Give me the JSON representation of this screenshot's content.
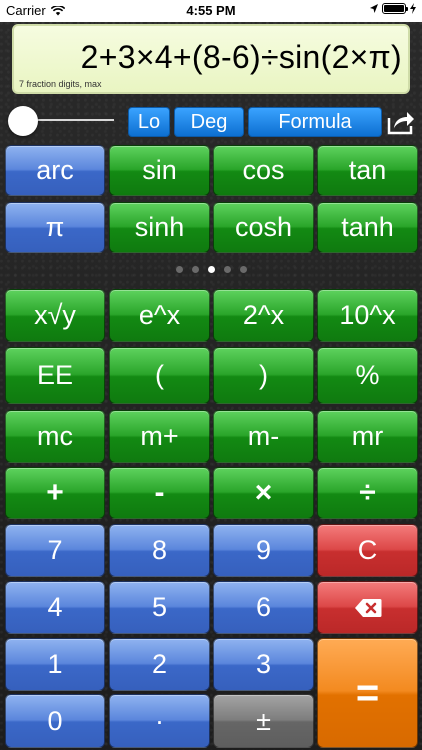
{
  "status_bar": {
    "carrier": "Carrier",
    "time": "4:55 PM"
  },
  "display": {
    "expression": "2+3×4+(8-6)÷sin(2×π)",
    "precision_note": "7 fraction digits, max"
  },
  "controls": {
    "precision_slider": 0.0,
    "modes": [
      "Lo",
      "Deg",
      "Formula"
    ]
  },
  "function_rows": [
    [
      "arc",
      "sin",
      "cos",
      "tan"
    ],
    [
      "π",
      "sinh",
      "cosh",
      "tanh"
    ]
  ],
  "page_indicator": {
    "count": 5,
    "active": 2
  },
  "keypad_rows": [
    [
      "x√y",
      "e^x",
      "2^x",
      "10^x"
    ],
    [
      "EE",
      "(",
      ")",
      "%"
    ],
    [
      "mc",
      "m+",
      "m-",
      "mr"
    ],
    [
      "+",
      "-",
      "×",
      "÷"
    ],
    [
      "7",
      "8",
      "9",
      "C"
    ],
    [
      "4",
      "5",
      "6",
      "⌫"
    ],
    [
      "1",
      "2",
      "3",
      "="
    ],
    [
      "0",
      "·",
      "±"
    ]
  ],
  "colors": {
    "green": "#2aa52a",
    "blue": "#3b68c8",
    "red": "#c82f2f",
    "orange": "#e27100",
    "gray": "#666666"
  }
}
